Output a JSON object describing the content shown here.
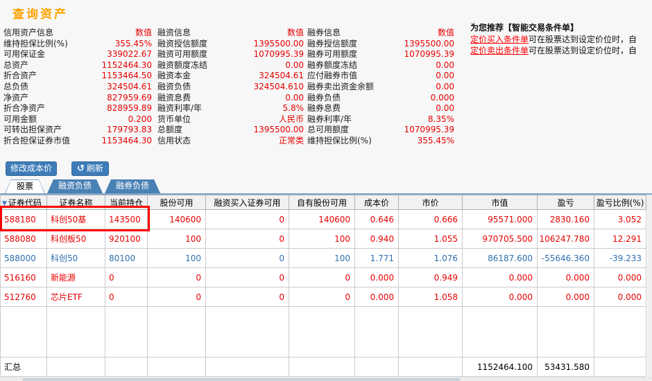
{
  "page_title": "查询资产",
  "info_groups": [
    {
      "header": "信用资产信息",
      "value_header": "数值",
      "rows": [
        [
          "维持担保比例(%)",
          "355.45%"
        ],
        [
          "可用保证金",
          "339022.67"
        ],
        [
          "总资产",
          "1152464.30"
        ],
        [
          "折合资产",
          "1153464.50"
        ],
        [
          "总负债",
          "324504.61"
        ],
        [
          "净资产",
          "827959.69"
        ],
        [
          "折合净资产",
          "828959.89"
        ],
        [
          "可用金额",
          "0.200"
        ],
        [
          "可转出担保资产",
          "179793.83"
        ],
        [
          "折合担保证券市值",
          "1153464.30"
        ]
      ]
    },
    {
      "header": "融资信息",
      "value_header": "数值",
      "rows": [
        [
          "融资授信额度",
          "1395500.00"
        ],
        [
          "融资可用额度",
          "1070995.39"
        ],
        [
          "融资额度冻结",
          "0.00"
        ],
        [
          "融资本金",
          "324504.61"
        ],
        [
          "融资负债",
          "324504.610"
        ],
        [
          "融资息费",
          "0.00"
        ],
        [
          "融资利率/年",
          "5.8%"
        ],
        [
          "货币单位",
          "人民币"
        ],
        [
          "总额度",
          "1395500.00"
        ],
        [
          "信用状态",
          "正常类"
        ]
      ]
    },
    {
      "header": "融券信息",
      "value_header": "数值",
      "rows": [
        [
          "融券授信额度",
          "1395500.00"
        ],
        [
          "融券可用额度",
          "1070995.39"
        ],
        [
          "融券额度冻结",
          "0.00"
        ],
        [
          "应付融券市值",
          "0.00"
        ],
        [
          "融券卖出资金余额",
          "0.00"
        ],
        [
          "融券负债",
          "0.000"
        ],
        [
          "融券息费",
          "0.00"
        ],
        [
          "融券利率/年",
          "8.35%"
        ],
        [
          "总可用额度",
          "1070995.39"
        ],
        [
          "维持担保比例(%)",
          "355.45%"
        ]
      ]
    }
  ],
  "promo": {
    "title": "为您推荐【智能交易条件单】",
    "lines": [
      {
        "link": "定价买入条件单",
        "text": "可在股票达到设定价位时，自"
      },
      {
        "link": "定价卖出条件单",
        "text": "可在股票达到设定价位时，自"
      }
    ]
  },
  "toolbar": {
    "modify_cost": "修改成本价",
    "refresh": "刷新",
    "refresh_icon_glyph": "↺"
  },
  "tabs": [
    {
      "label": "股票",
      "active": true
    },
    {
      "label": "融资负债",
      "active": false
    },
    {
      "label": "融券负债",
      "active": false
    }
  ],
  "table": {
    "columns": [
      "证券代码",
      "证券名称",
      "当前持仓",
      "股份可用",
      "融资买入证券可用",
      "自有股份可用",
      "成本价",
      "市价",
      "市值",
      "盈亏",
      "盈亏比例(%)"
    ],
    "rows": [
      {
        "trend": "up",
        "cells": [
          "588180",
          "科创50基",
          "143500",
          "140600",
          "0",
          "140600",
          "0.646",
          "0.666",
          "95571.000",
          "2830.160",
          "3.052"
        ]
      },
      {
        "trend": "up",
        "cells": [
          "588080",
          "科创板50",
          "920100",
          "100",
          "0",
          "100",
          "0.940",
          "1.055",
          "970705.500",
          "106247.780",
          "12.291"
        ]
      },
      {
        "trend": "down",
        "cells": [
          "588000",
          "科创50",
          "80100",
          "100",
          "0",
          "100",
          "1.771",
          "1.076",
          "86187.600",
          "-55646.360",
          "-39.233"
        ]
      },
      {
        "trend": "up",
        "cells": [
          "516160",
          "新能源",
          "0",
          "0",
          "0",
          "0",
          "0.000",
          "0.949",
          "0.000",
          "0.000",
          "0.000"
        ]
      },
      {
        "trend": "up",
        "cells": [
          "512760",
          "芯片ETF",
          "0",
          "0",
          "0",
          "0",
          "0.000",
          "1.058",
          "0.000",
          "0.000",
          "0.000"
        ]
      }
    ],
    "summary": {
      "label": "汇总",
      "market_value": "1152464.100",
      "pnl": "53431.580"
    }
  },
  "colors": {
    "title_orange": "#FFA200",
    "value_red": "#E60000",
    "row_down_blue": "#2F6FAE",
    "tab_blue": "#4A81B5",
    "button_blue": "#3E7CB8",
    "link_red": "#FF0000",
    "highlight_red": "#FF0000"
  }
}
